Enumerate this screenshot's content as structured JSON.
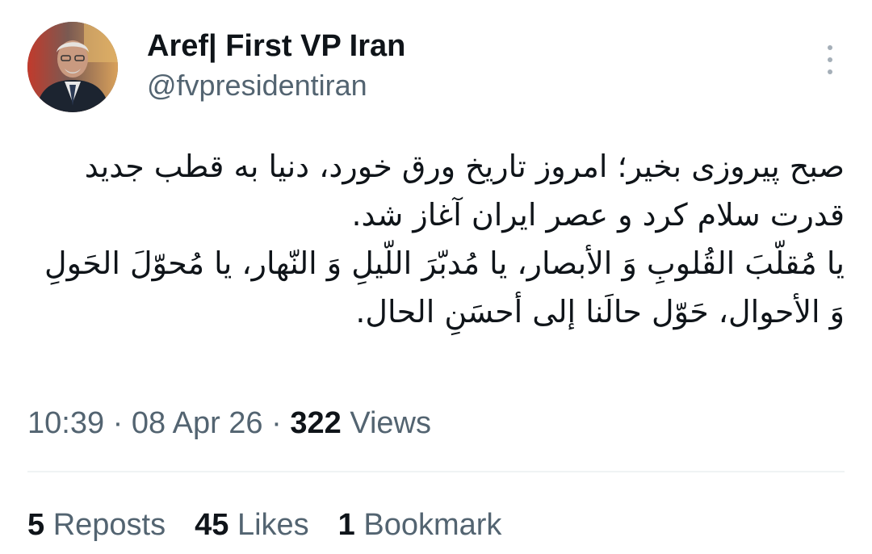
{
  "author": {
    "display_name": "Aref| First VP Iran",
    "handle": "@fvpresidentiran",
    "avatar_icon": "profile-photo"
  },
  "menu_icon": "more-vertical-icon",
  "tweet": {
    "paragraphs": [
      "صبح پیروزی بخیر؛ امروز تاریخ ورق خورد، دنیا به قطب جدید قدرت سلام کرد و عصر ایران آغاز شد.",
      "یا مُقلّبَ القُلوبِ وَ الأبصار، یا مُدبّرَ اللّیلِ وَ النّهار، یا مُحوّلَ الحَولِ وَ الأحوال، حَوّل حالَنا إلی أحسَنِ الحال."
    ]
  },
  "meta": {
    "time": "10:39",
    "date": "08 Apr 26",
    "separator": "·",
    "views_count": "322",
    "views_label": "Views"
  },
  "stats": {
    "reposts_count": "5",
    "reposts_label": "Reposts",
    "likes_count": "45",
    "likes_label": "Likes",
    "bookmarks_count": "1",
    "bookmarks_label": "Bookmark"
  },
  "colors": {
    "primary_text": "#0f1419",
    "secondary_text": "#536471",
    "divider": "#eff3f4"
  }
}
